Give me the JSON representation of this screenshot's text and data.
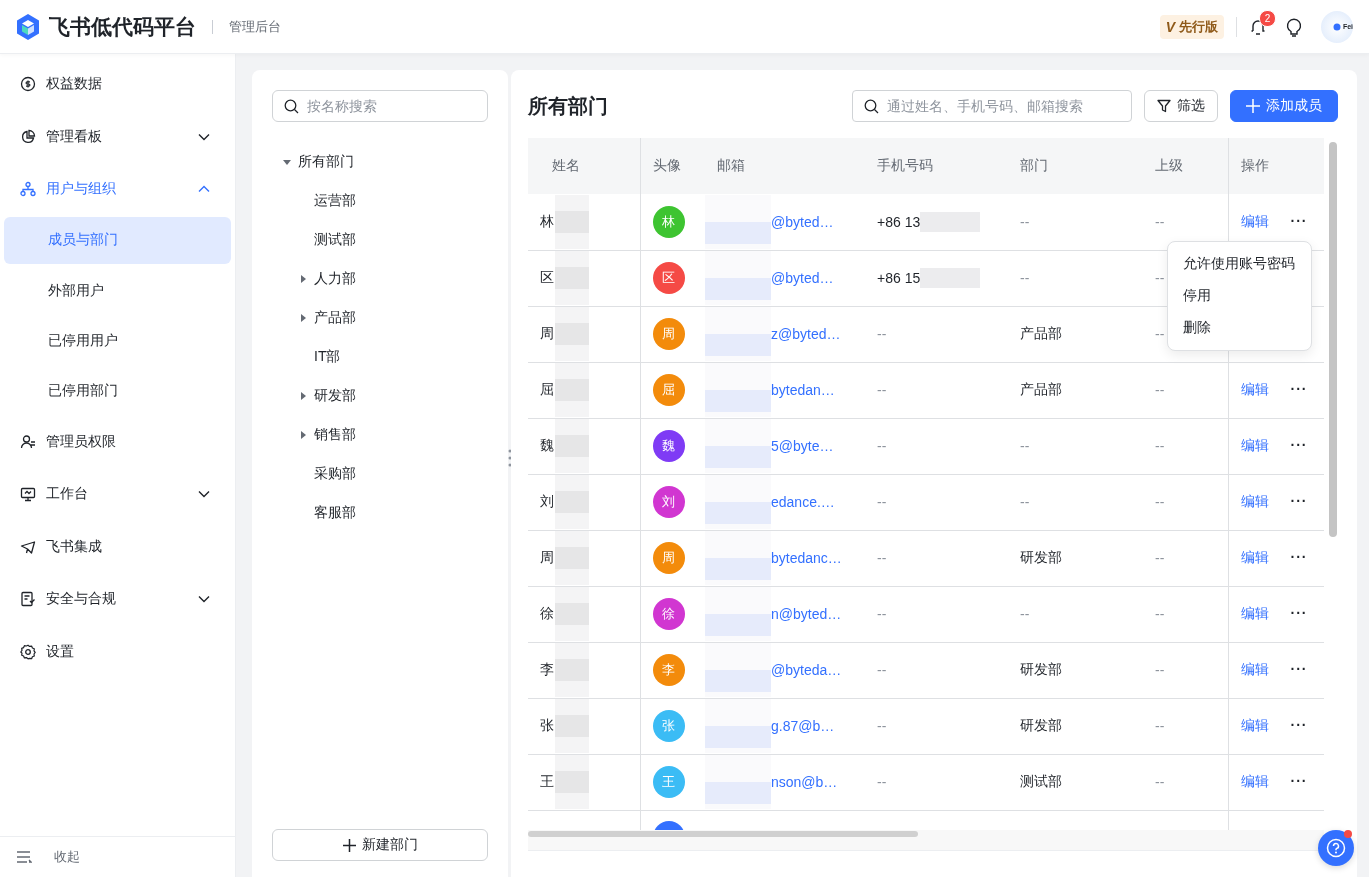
{
  "header": {
    "title": "飞书低代码平台",
    "subtitle": "管理后台",
    "edition": {
      "mark": "V",
      "label": "先行版"
    },
    "notifications": "2",
    "avatar_text": "Fei"
  },
  "sidebar": {
    "items": [
      {
        "label": "权益数据",
        "selected": false
      },
      {
        "label": "管理看板",
        "expanded": false,
        "selected": false
      },
      {
        "label": "用户与组织",
        "expanded": true,
        "selected": false,
        "children": [
          {
            "label": "成员与部门",
            "selected": true
          },
          {
            "label": "外部用户",
            "selected": false
          },
          {
            "label": "已停用用户",
            "selected": false
          },
          {
            "label": "已停用部门",
            "selected": false
          }
        ]
      },
      {
        "label": "管理员权限",
        "selected": false
      },
      {
        "label": "工作台",
        "expanded": false,
        "selected": false
      },
      {
        "label": "飞书集成",
        "selected": false
      },
      {
        "label": "安全与合规",
        "expanded": false,
        "selected": false
      },
      {
        "label": "设置",
        "selected": false
      }
    ],
    "collapse": "收起"
  },
  "departments": {
    "search": {
      "placeholder": "按名称搜索"
    },
    "tree": [
      {
        "label": "所有部门",
        "expanded": true,
        "children": [
          {
            "label": "运营部",
            "expandable": false
          },
          {
            "label": "测试部",
            "expandable": false
          },
          {
            "label": "人力部",
            "expandable": true
          },
          {
            "label": "产品部",
            "expandable": true
          },
          {
            "label": "IT部",
            "expandable": false
          },
          {
            "label": "研发部",
            "expandable": true
          },
          {
            "label": "销售部",
            "expandable": true
          },
          {
            "label": "采购部",
            "expandable": false
          },
          {
            "label": "客服部",
            "expandable": false
          }
        ]
      }
    ],
    "new_button": "新建部门"
  },
  "members": {
    "title": "所有部门",
    "search": {
      "placeholder": "通过姓名、手机号码、邮箱搜索"
    },
    "filter_button": "筛选",
    "add_button": "添加成员",
    "table": {
      "columns": [
        "姓名",
        "头像",
        "邮箱",
        "手机号码",
        "部门",
        "上级",
        "操作"
      ],
      "rows": [
        {
          "name": "林",
          "avatar": "林",
          "color": "#3ec431",
          "email": "@byted…",
          "phone": "+86 13",
          "department": "--",
          "superior": "--",
          "edit": "编辑",
          "more": "···"
        },
        {
          "name": "区",
          "avatar": "区",
          "color": "#f54a45",
          "email": "@byted…",
          "phone": "+86 15",
          "department": "--",
          "superior": "--"
        },
        {
          "name": "周",
          "avatar": "周",
          "color": "#f38b0b",
          "email": "z@byted…",
          "phone": "--",
          "department": "产品部",
          "superior": "--"
        },
        {
          "name": "屈",
          "avatar": "屈",
          "color": "#f38b0b",
          "email": "bytedan…",
          "phone": "--",
          "department": "产品部",
          "superior": "--",
          "edit": "编辑",
          "more": "···"
        },
        {
          "name": "魏",
          "avatar": "魏",
          "color": "#7f3bf5",
          "email": "5@byte…",
          "phone": "--",
          "department": "--",
          "superior": "--",
          "edit": "编辑",
          "more": "···"
        },
        {
          "name": "刘",
          "avatar": "刘",
          "color": "#d136d1",
          "email": "edance.…",
          "phone": "--",
          "department": "--",
          "superior": "--",
          "edit": "编辑",
          "more": "···"
        },
        {
          "name": "周",
          "avatar": "周",
          "color": "#f38b0b",
          "email": "bytedanc…",
          "phone": "--",
          "department": "研发部",
          "superior": "--",
          "edit": "编辑",
          "more": "···"
        },
        {
          "name": "徐",
          "avatar": "徐",
          "color": "#d136d1",
          "email": "n@byted…",
          "phone": "--",
          "department": "--",
          "superior": "--",
          "edit": "编辑",
          "more": "···"
        },
        {
          "name": "李",
          "avatar": "李",
          "color": "#f38b0b",
          "email": "@byteda…",
          "phone": "--",
          "department": "研发部",
          "superior": "--",
          "edit": "编辑",
          "more": "···"
        },
        {
          "name": "张",
          "avatar": "张",
          "color": "#3bbcf5",
          "email": "g.87@b…",
          "phone": "--",
          "department": "研发部",
          "superior": "--",
          "edit": "编辑",
          "more": "···"
        },
        {
          "name": "王",
          "avatar": "王",
          "color": "#3bbcf5",
          "email": "nson@b…",
          "phone": "--",
          "department": "测试部",
          "superior": "--",
          "edit": "编辑",
          "more": "···"
        },
        {
          "color": "#3370ff"
        }
      ]
    },
    "menu": [
      "允许使用账号密码",
      "停用",
      "删除"
    ]
  }
}
